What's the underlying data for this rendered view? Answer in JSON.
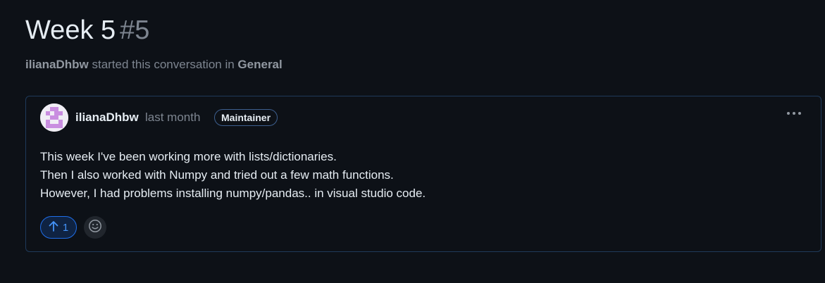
{
  "discussion": {
    "title": "Week 5",
    "number": "#5",
    "author": "ilianaDhbw",
    "started_text": "started this conversation in",
    "category": "General"
  },
  "post": {
    "author": "ilianaDhbw",
    "time": "last month",
    "badge": "Maintainer",
    "lines": [
      "This week I've been working more with lists/dictionaries.",
      "Then I also worked with Numpy and tried out a few math functions.",
      "However, I had problems installing numpy/pandas.. in visual studio code."
    ],
    "upvote_count": "1",
    "icons": {
      "more": "kebab-horizontal-icon",
      "upvote": "arrow-up-icon",
      "react": "smiley-icon"
    }
  },
  "colors": {
    "background": "#0d1117",
    "accent": "#4493f8",
    "muted": "#7d8590",
    "border": "#1f3a5a"
  }
}
